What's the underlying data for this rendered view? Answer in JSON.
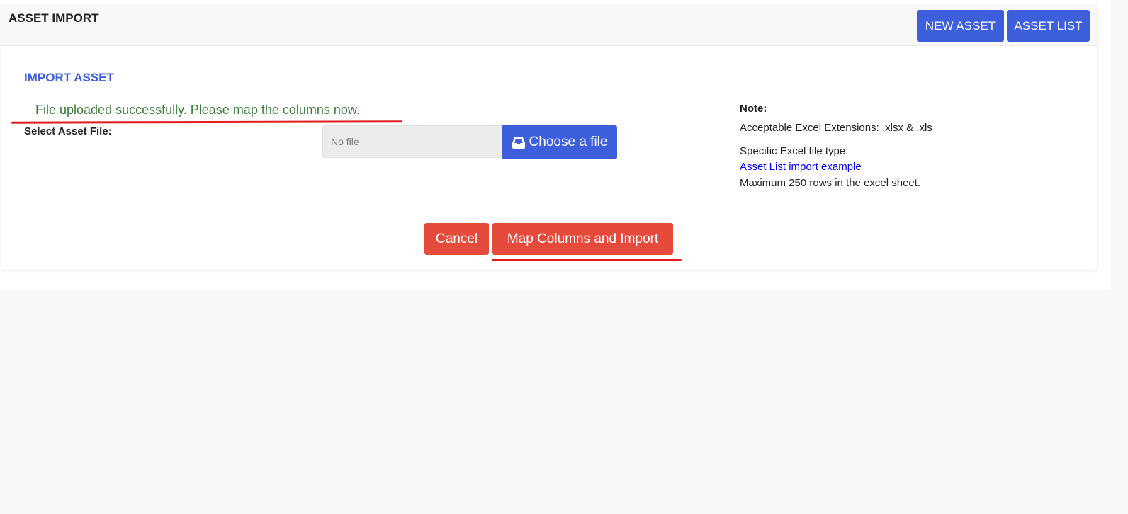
{
  "header": {
    "title": "ASSET IMPORT",
    "new_asset_label": "NEW ASSET",
    "asset_list_label": "ASSET LIST"
  },
  "form": {
    "section_title": "IMPORT ASSET",
    "success_message": "File uploaded successfully. Please map the columns now.",
    "file_label": "Select Asset File:",
    "file_value": "No file",
    "choose_button_label": "Choose a file",
    "cancel_label": "Cancel",
    "import_label": "Map Columns and Import"
  },
  "note": {
    "title": "Note:",
    "extensions": "Acceptable Excel Extensions: .xlsx & .xls",
    "file_type": "Specific Excel file type:",
    "example_link": "Asset List import example",
    "max_rows": "Maximum 250 rows in the excel sheet."
  },
  "colors": {
    "primary_blue": "#3d5fdb",
    "danger_red": "#e64a3b",
    "success_green": "#3a7d3a",
    "annotation_red": "#e01e1e"
  },
  "icons": {
    "choose_file_icon": "inbox-icon"
  }
}
